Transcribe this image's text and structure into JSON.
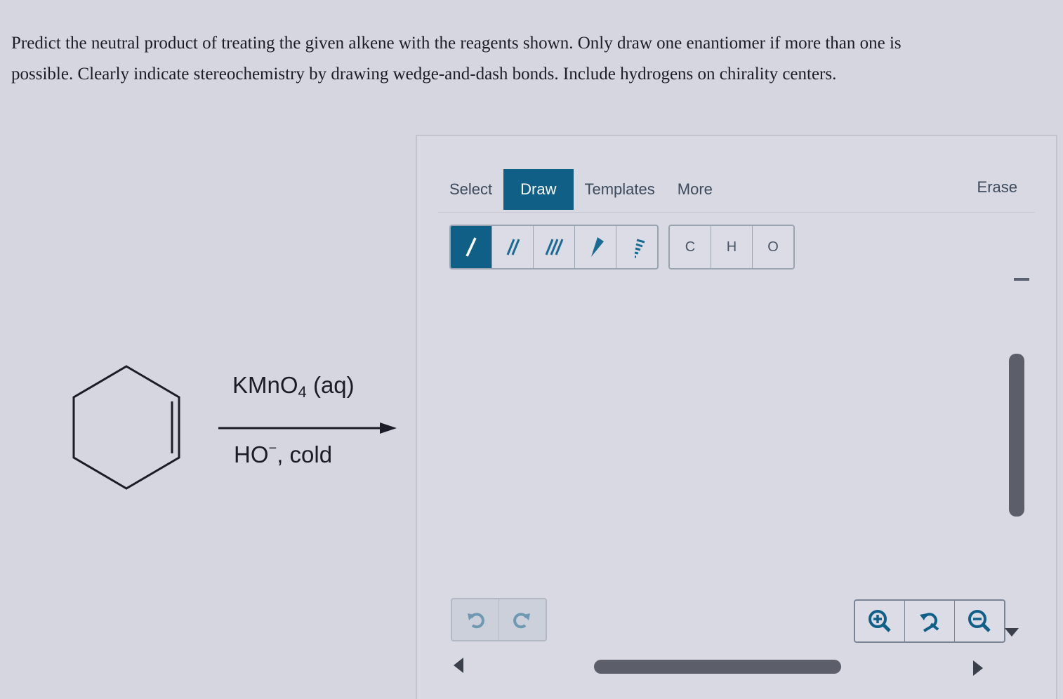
{
  "question": {
    "line1": "Predict the neutral product of treating the given alkene with the reagents shown. Only draw one enantiomer if more than one is",
    "line2": "possible. Clearly indicate stereochemistry by drawing wedge-and-dash bonds. Include hydrogens on chirality centers."
  },
  "reaction": {
    "reagent_top_main": "KMnO",
    "reagent_top_sub": "4",
    "reagent_top_suffix": " (aq)",
    "reagent_bottom_main": "HO",
    "reagent_bottom_sup": "−",
    "reagent_bottom_suffix": ", cold"
  },
  "editor": {
    "tabs": [
      "Select",
      "Draw",
      "Templates",
      "More"
    ],
    "active_tab": "Draw",
    "erase_label": "Erase",
    "bond_tools": [
      "single-bond",
      "double-bond",
      "triple-bond",
      "wedge-bond",
      "dash-bond"
    ],
    "active_bond": "single-bond",
    "atoms": [
      "C",
      "H",
      "O"
    ]
  },
  "icons": {
    "undo": "undo-icon",
    "redo": "redo-icon",
    "zoom_in": "zoom-in-icon",
    "zoom_reset": "zoom-reset-icon",
    "zoom_out": "zoom-out-icon"
  },
  "colors": {
    "accent": "#0f5f86",
    "icon_blue": "#1a6b93"
  }
}
